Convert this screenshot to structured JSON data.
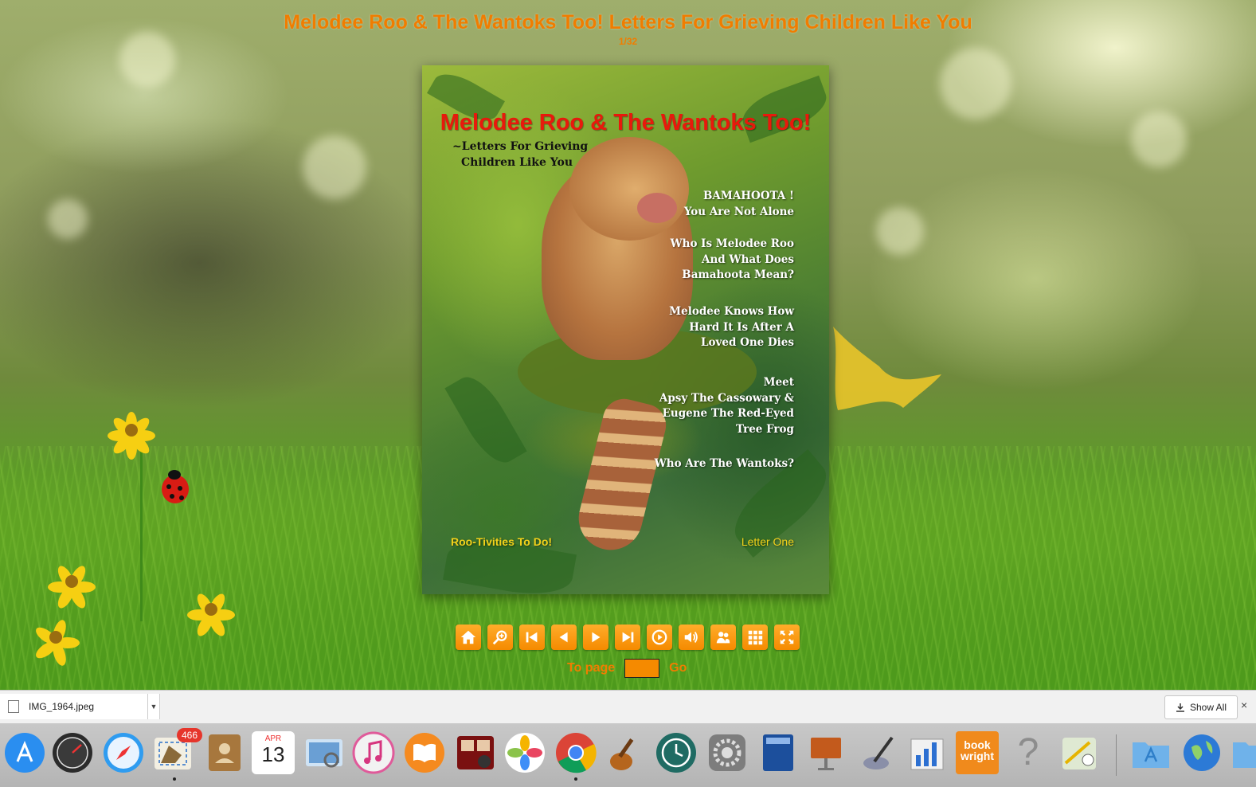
{
  "book": {
    "title": "Melodee Roo & The Wantoks Too! Letters For Grieving Children Like You",
    "page_indicator": "1/32"
  },
  "cover": {
    "title": "Melodee Roo & The Wantoks Too!",
    "subtitle_line1": "~Letters For Grieving",
    "subtitle_line2": "Children Like You",
    "toc": [
      [
        "BAMAHOOTA !",
        "You Are Not Alone"
      ],
      [
        "Who Is Melodee Roo",
        "And What Does",
        "Bamahoota Mean?"
      ],
      [
        "Melodee Knows How",
        "Hard It Is After A",
        "Loved One Dies"
      ],
      [
        "Meet",
        "Apsy The Cassowary &",
        "Eugene The Red-Eyed",
        "Tree Frog"
      ],
      [
        "Who Are The Wantoks?"
      ]
    ],
    "footer_left": "Roo-Tivities To Do!",
    "footer_right": "Letter One"
  },
  "toolbar": {
    "buttons": [
      "home-icon",
      "zoom-icon",
      "first-page-icon",
      "previous-page-icon",
      "next-page-icon",
      "last-page-icon",
      "autoplay-icon",
      "sound-icon",
      "share-icon",
      "thumbnails-icon",
      "fullscreen-icon"
    ],
    "goto_label": "To page",
    "goto_value": "",
    "go_label": "Go"
  },
  "downloads": {
    "file_name": "IMG_1964.jpeg",
    "show_all_label": "Show All",
    "close_label": "×"
  },
  "dock": {
    "mail_badge": "466",
    "calendar_month": "APR",
    "calendar_day": "13",
    "book_wright_line1": "book",
    "book_wright_line2": "wright",
    "help_glyph": "?"
  },
  "colors": {
    "accent_orange": "#f07d00",
    "cover_title_red": "#e8190c",
    "cover_footer_yellow": "#f3d21a"
  }
}
